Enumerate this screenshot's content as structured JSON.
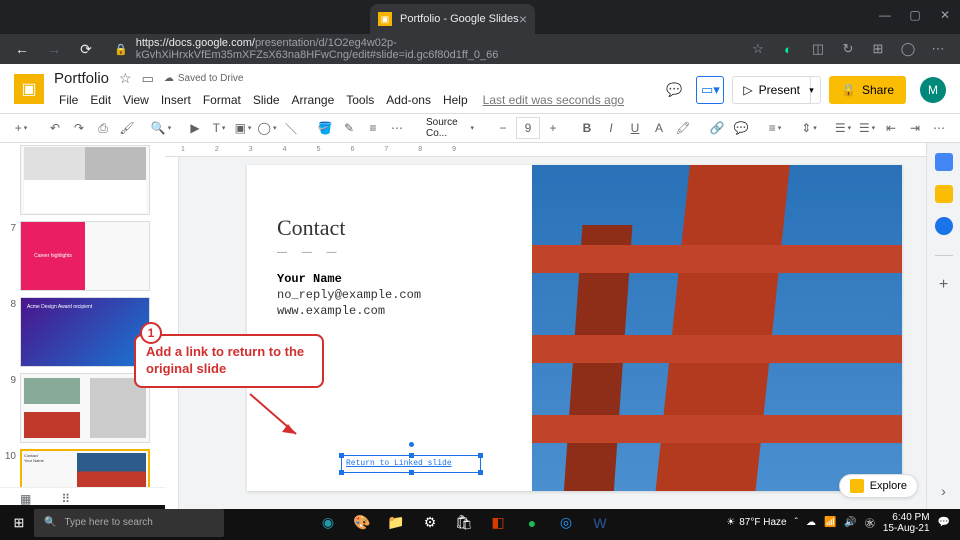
{
  "browser": {
    "tab_title": "Portfolio - Google Slides",
    "url_host": "https://docs.google.com/",
    "url_path": "presentation/d/1O2eg4w02p-kGvhXiHrxkVfEm35mXFZsX63na8HFwCng/edit#slide=id.gc6f80d1ff_0_66"
  },
  "app": {
    "doc_title": "Portfolio",
    "saved_status": "Saved to Drive",
    "last_edit": "Last edit was seconds ago",
    "menus": [
      "File",
      "Edit",
      "View",
      "Insert",
      "Format",
      "Slide",
      "Arrange",
      "Tools",
      "Add-ons",
      "Help"
    ],
    "present": "Present",
    "share": "Share",
    "avatar_letter": "M"
  },
  "toolbar": {
    "font": "Source Co...",
    "size_minus": "−",
    "size": "9",
    "size_plus": "+"
  },
  "filmstrip": {
    "thumbs": [
      {
        "num": "",
        "label": ""
      },
      {
        "num": "7",
        "label": "Career highlights"
      },
      {
        "num": "8",
        "label": "Acme Design Award recipient"
      },
      {
        "num": "9",
        "label": ""
      },
      {
        "num": "10",
        "label": ""
      }
    ]
  },
  "slide": {
    "heading": "Contact",
    "dashes": "— — —",
    "name": "Your Name",
    "email": "no_reply@example.com",
    "website": "www.example.com",
    "link_text": "Return to Linked slide"
  },
  "callout": {
    "num": "1",
    "text": "Add a link to return to the original slide"
  },
  "ruler": "123456789",
  "explore": "Explore",
  "taskbar": {
    "search_placeholder": "Type here to search",
    "weather": "87°F Haze",
    "time": "6:40 PM",
    "date": "15-Aug-21"
  }
}
